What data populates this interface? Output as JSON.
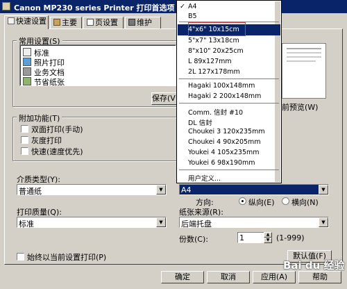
{
  "window": {
    "title": "Canon MP230 series Printer 打印首选项"
  },
  "tabs": [
    {
      "label": "快速设置"
    },
    {
      "label": "主要"
    },
    {
      "label": "页设置"
    },
    {
      "label": "维护"
    }
  ],
  "common_settings": {
    "label": "常用设置(S)",
    "items": [
      "标准",
      "照片打印",
      "业务文档",
      "节省纸张"
    ],
    "save_label": "保存(V)",
    "preview_label": "前预览(W)"
  },
  "additional_features": {
    "label": "附加功能(T)",
    "options": [
      "双面打印(手动)",
      "灰度打印",
      "快速(速度优先)"
    ]
  },
  "media_type": {
    "label": "介质类型(Y):",
    "value": "普通纸"
  },
  "paper_size": {
    "value": "A4"
  },
  "print_quality": {
    "label": "打印质量(Q):",
    "value": "标准"
  },
  "orientation": {
    "label": "方向:",
    "portrait": "纵向(E)",
    "landscape": "横向(N)"
  },
  "paper_source": {
    "label": "纸张来源(R):",
    "value": "后端托盘"
  },
  "copies": {
    "label": "份数(C):",
    "value": "1",
    "range": "(1-999)"
  },
  "always_print_current": "始终以当前设置打印(P)",
  "defaults_label": "默认值(F)",
  "buttons": {
    "ok": "确定",
    "cancel": "取消",
    "apply": "应用(A)",
    "help": "帮助"
  },
  "dropdown": {
    "checked_mark": "✓",
    "items": [
      "A4",
      "B5",
      "4\"x6\" 10x15cm",
      "5\"x7\" 13x18cm",
      "8\"x10\" 20x25cm",
      "L 89x127mm",
      "2L 127x178mm",
      "Hagaki 100x148mm",
      "Hagaki 2 200x148mm",
      "Comm. 信封 #10",
      "DL 信封",
      "Choukei 3 120x235mm",
      "Choukei 4 90x205mm",
      "Youkei 4 105x235mm",
      "Youkei 6 98x190mm",
      "用户定义..."
    ]
  },
  "watermark": "Bai du 经验"
}
